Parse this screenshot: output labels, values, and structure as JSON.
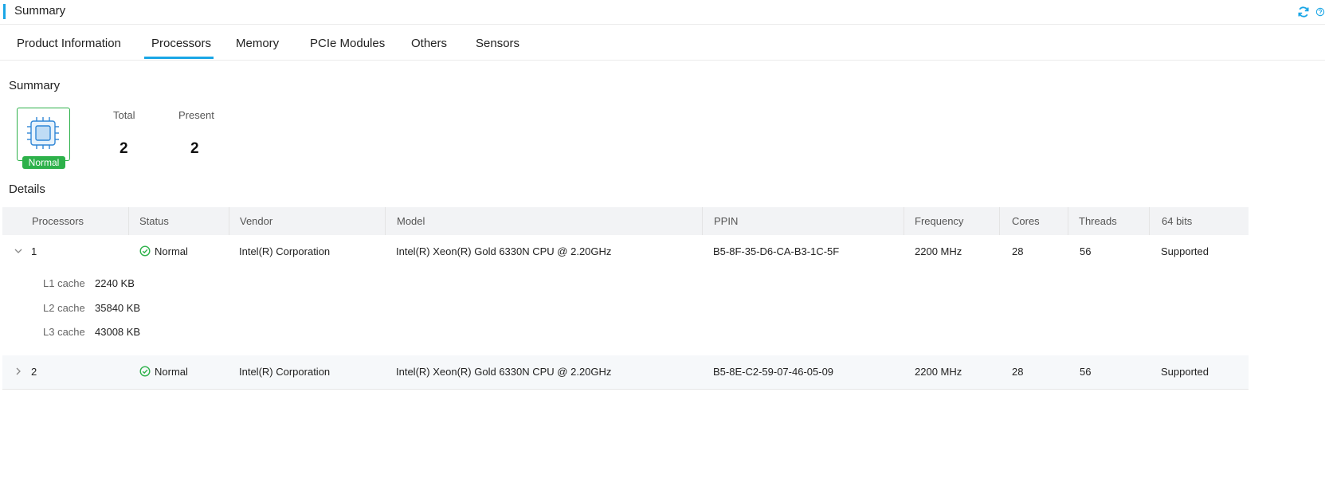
{
  "header": {
    "title": "Summary",
    "refresh_icon": "refresh-icon",
    "help_icon": "help-icon",
    "accent_color": "#1aa6e6"
  },
  "tabs": [
    {
      "label": "Product Information"
    },
    {
      "label": "Processors",
      "active": true
    },
    {
      "label": "Memory"
    },
    {
      "label": "PCIe Modules"
    },
    {
      "label": "Others"
    },
    {
      "label": "Sensors"
    }
  ],
  "summary": {
    "title": "Summary",
    "status": "Normal",
    "status_color": "#2db14a",
    "total_label": "Total",
    "total_value": "2",
    "present_label": "Present",
    "present_value": "2"
  },
  "details": {
    "title": "Details",
    "columns": [
      "Processors",
      "Status",
      "Vendor",
      "Model",
      "PPIN",
      "Frequency",
      "Cores",
      "Threads",
      "64 bits"
    ],
    "rows": [
      {
        "id": "1",
        "expanded": true,
        "status": "Normal",
        "vendor": "Intel(R) Corporation",
        "model": "Intel(R) Xeon(R) Gold 6330N CPU @ 2.20GHz",
        "ppin": "B5-8F-35-D6-CA-B3-1C-5F",
        "frequency": "2200 MHz",
        "cores": "28",
        "threads": "56",
        "bits64": "Supported",
        "caches": [
          {
            "label": "L1 cache",
            "value": "2240 KB"
          },
          {
            "label": "L2 cache",
            "value": "35840 KB"
          },
          {
            "label": "L3 cache",
            "value": "43008 KB"
          }
        ]
      },
      {
        "id": "2",
        "expanded": false,
        "status": "Normal",
        "vendor": "Intel(R) Corporation",
        "model": "Intel(R) Xeon(R) Gold 6330N CPU @ 2.20GHz",
        "ppin": "B5-8E-C2-59-07-46-05-09",
        "frequency": "2200 MHz",
        "cores": "28",
        "threads": "56",
        "bits64": "Supported"
      }
    ]
  }
}
